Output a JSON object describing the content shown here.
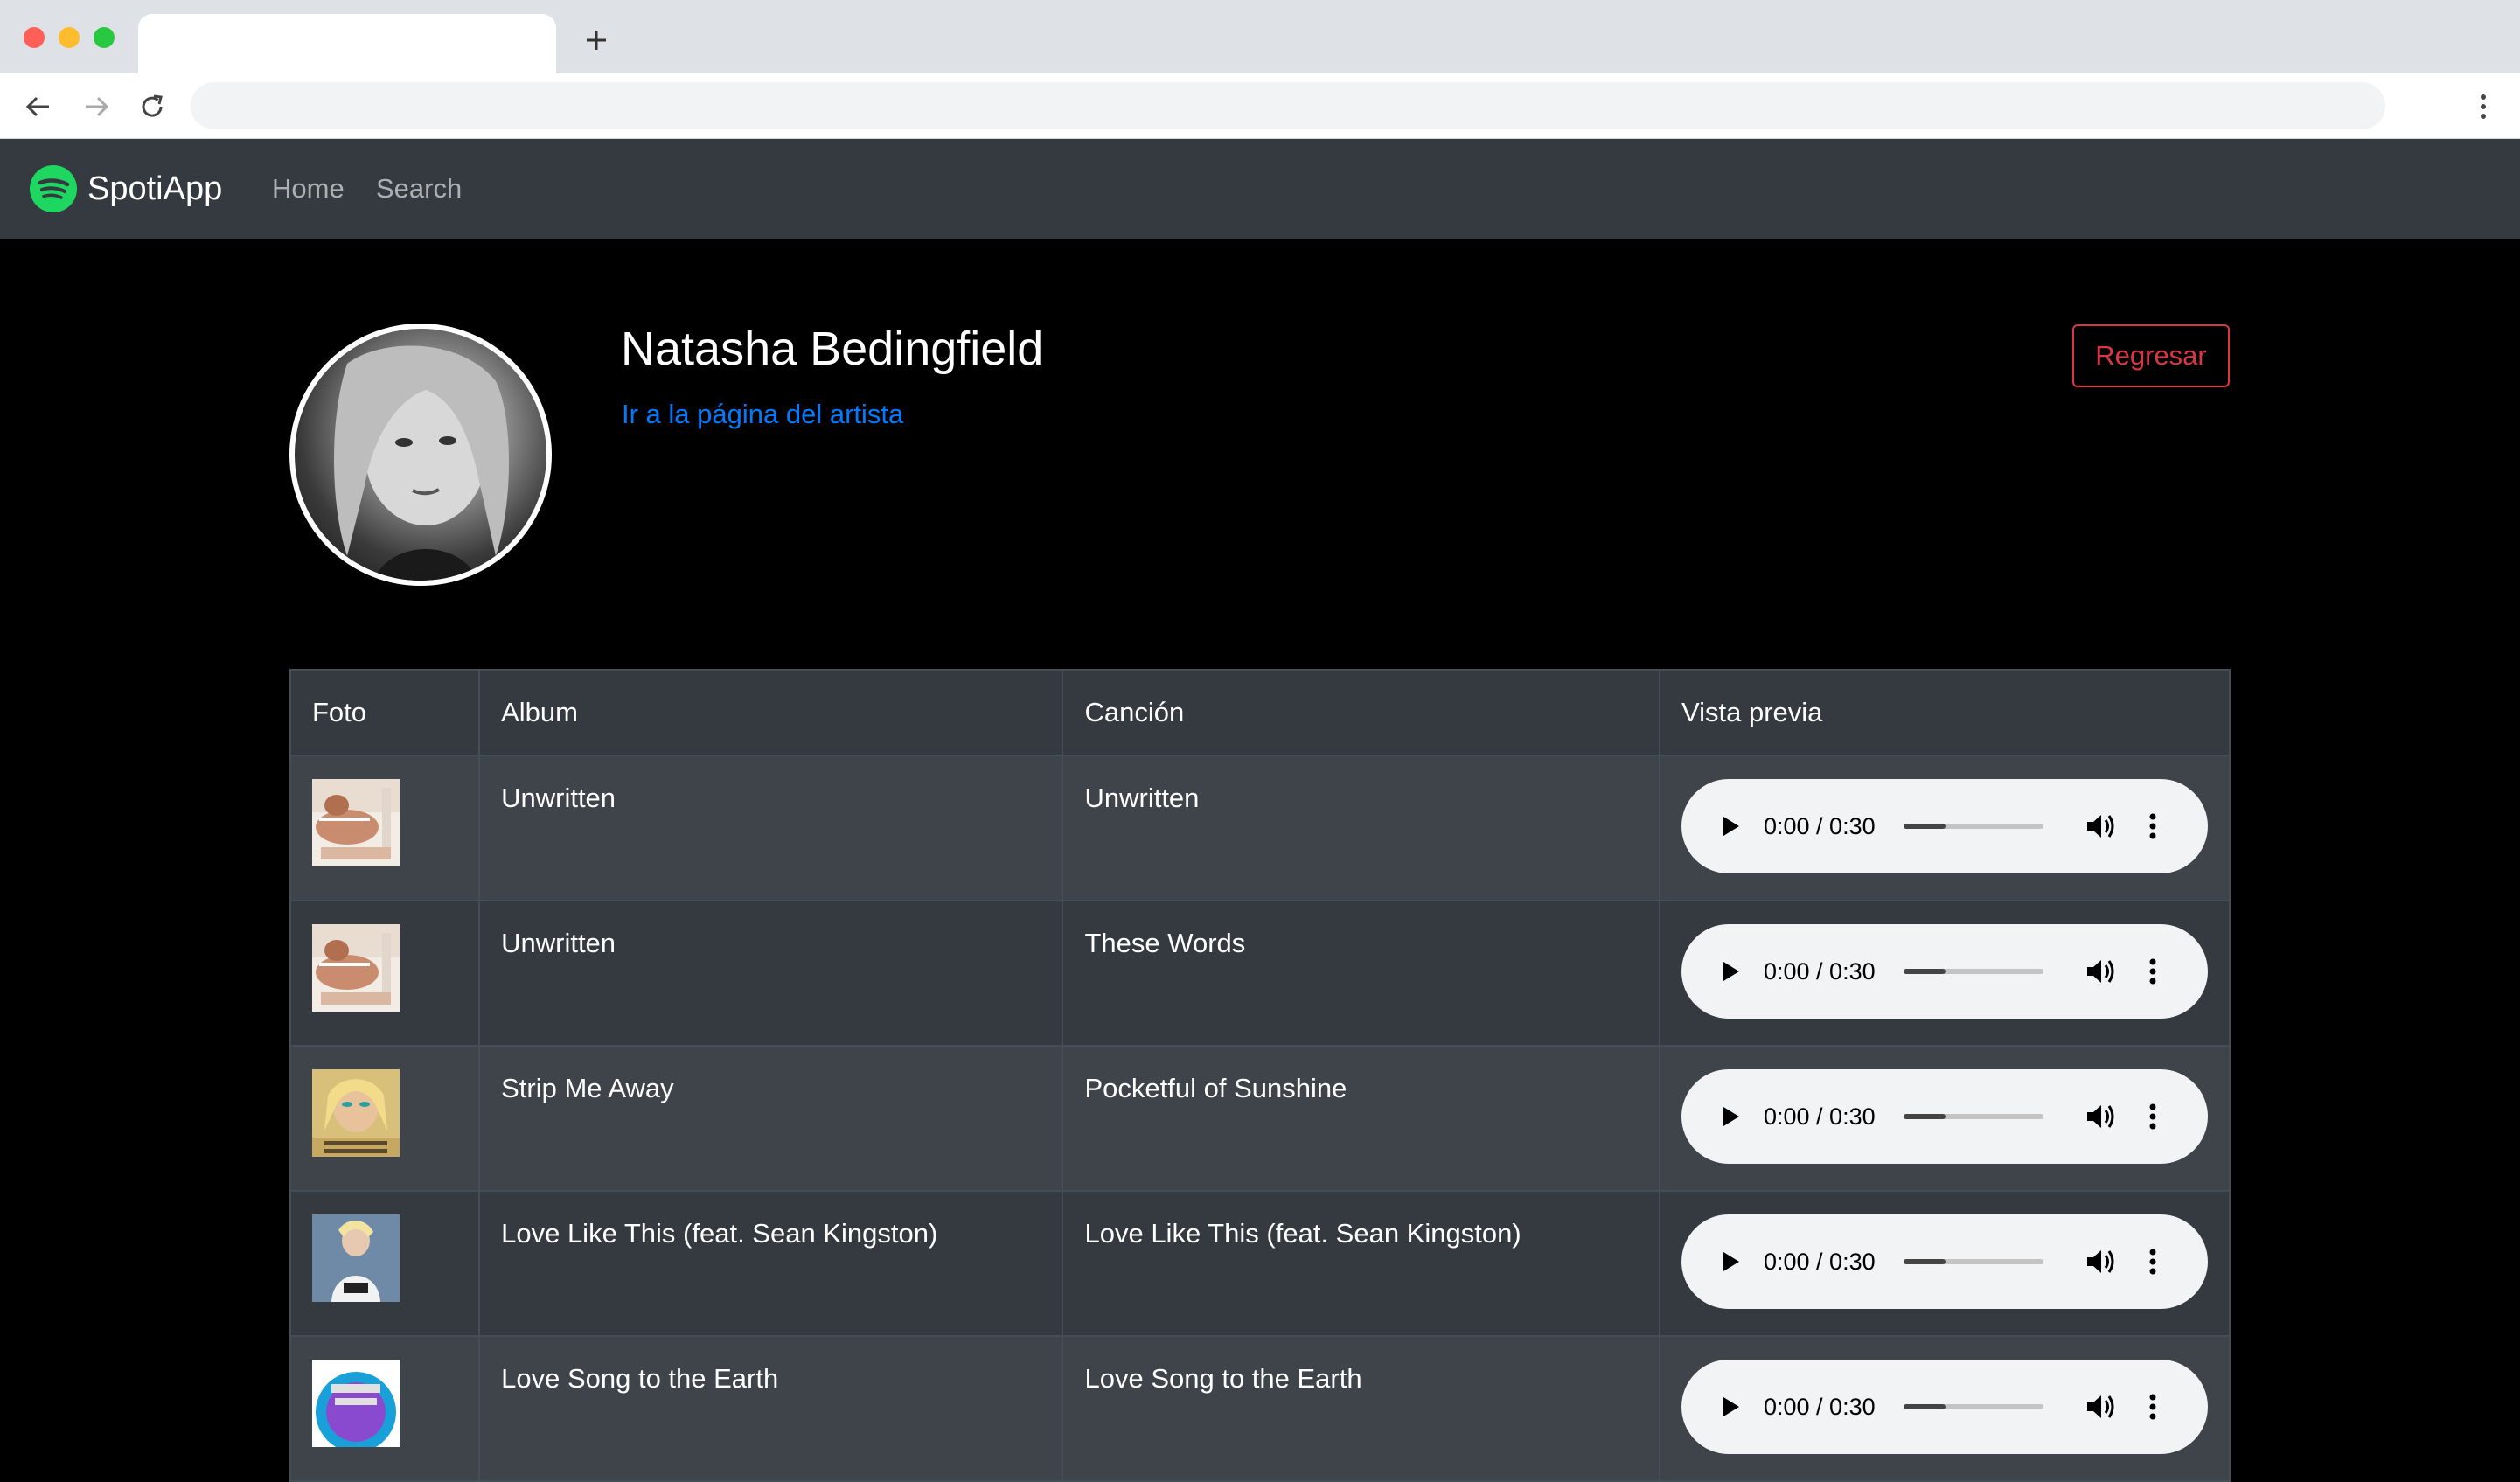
{
  "app": {
    "brand": "SpotiApp",
    "nav": [
      {
        "label": "Home"
      },
      {
        "label": "Search"
      }
    ]
  },
  "artist": {
    "name": "Natasha Bedingfield",
    "link_text": "Ir a la página del artista",
    "back_button": "Regresar"
  },
  "table": {
    "headers": [
      "Foto",
      "Album",
      "Canción",
      "Vista previa"
    ],
    "rows": [
      {
        "album": "Unwritten",
        "song": "Unwritten",
        "time": "0:00 / 0:30",
        "progress": 0.3,
        "thumb": "unwritten"
      },
      {
        "album": "Unwritten",
        "song": "These Words",
        "time": "0:00 / 0:30",
        "progress": 0.3,
        "thumb": "unwritten"
      },
      {
        "album": "Strip Me Away",
        "song": "Pocketful of Sunshine",
        "time": "0:00 / 0:30",
        "progress": 0.3,
        "thumb": "strip-me-away"
      },
      {
        "album": "Love Like This (feat. Sean Kingston)",
        "song": "Love Like This (feat. Sean Kingston)",
        "time": "0:00 / 0:30",
        "progress": 0.3,
        "thumb": "love-like-this"
      },
      {
        "album": "Love Song to the Earth",
        "song": "Love Song to the Earth",
        "time": "0:00 / 0:30",
        "progress": 0.3,
        "thumb": "love-song"
      }
    ]
  },
  "colors": {
    "navbar": "#343a40",
    "link": "#007bff",
    "danger": "#dc3545",
    "spotify_green": "#1ed760"
  }
}
